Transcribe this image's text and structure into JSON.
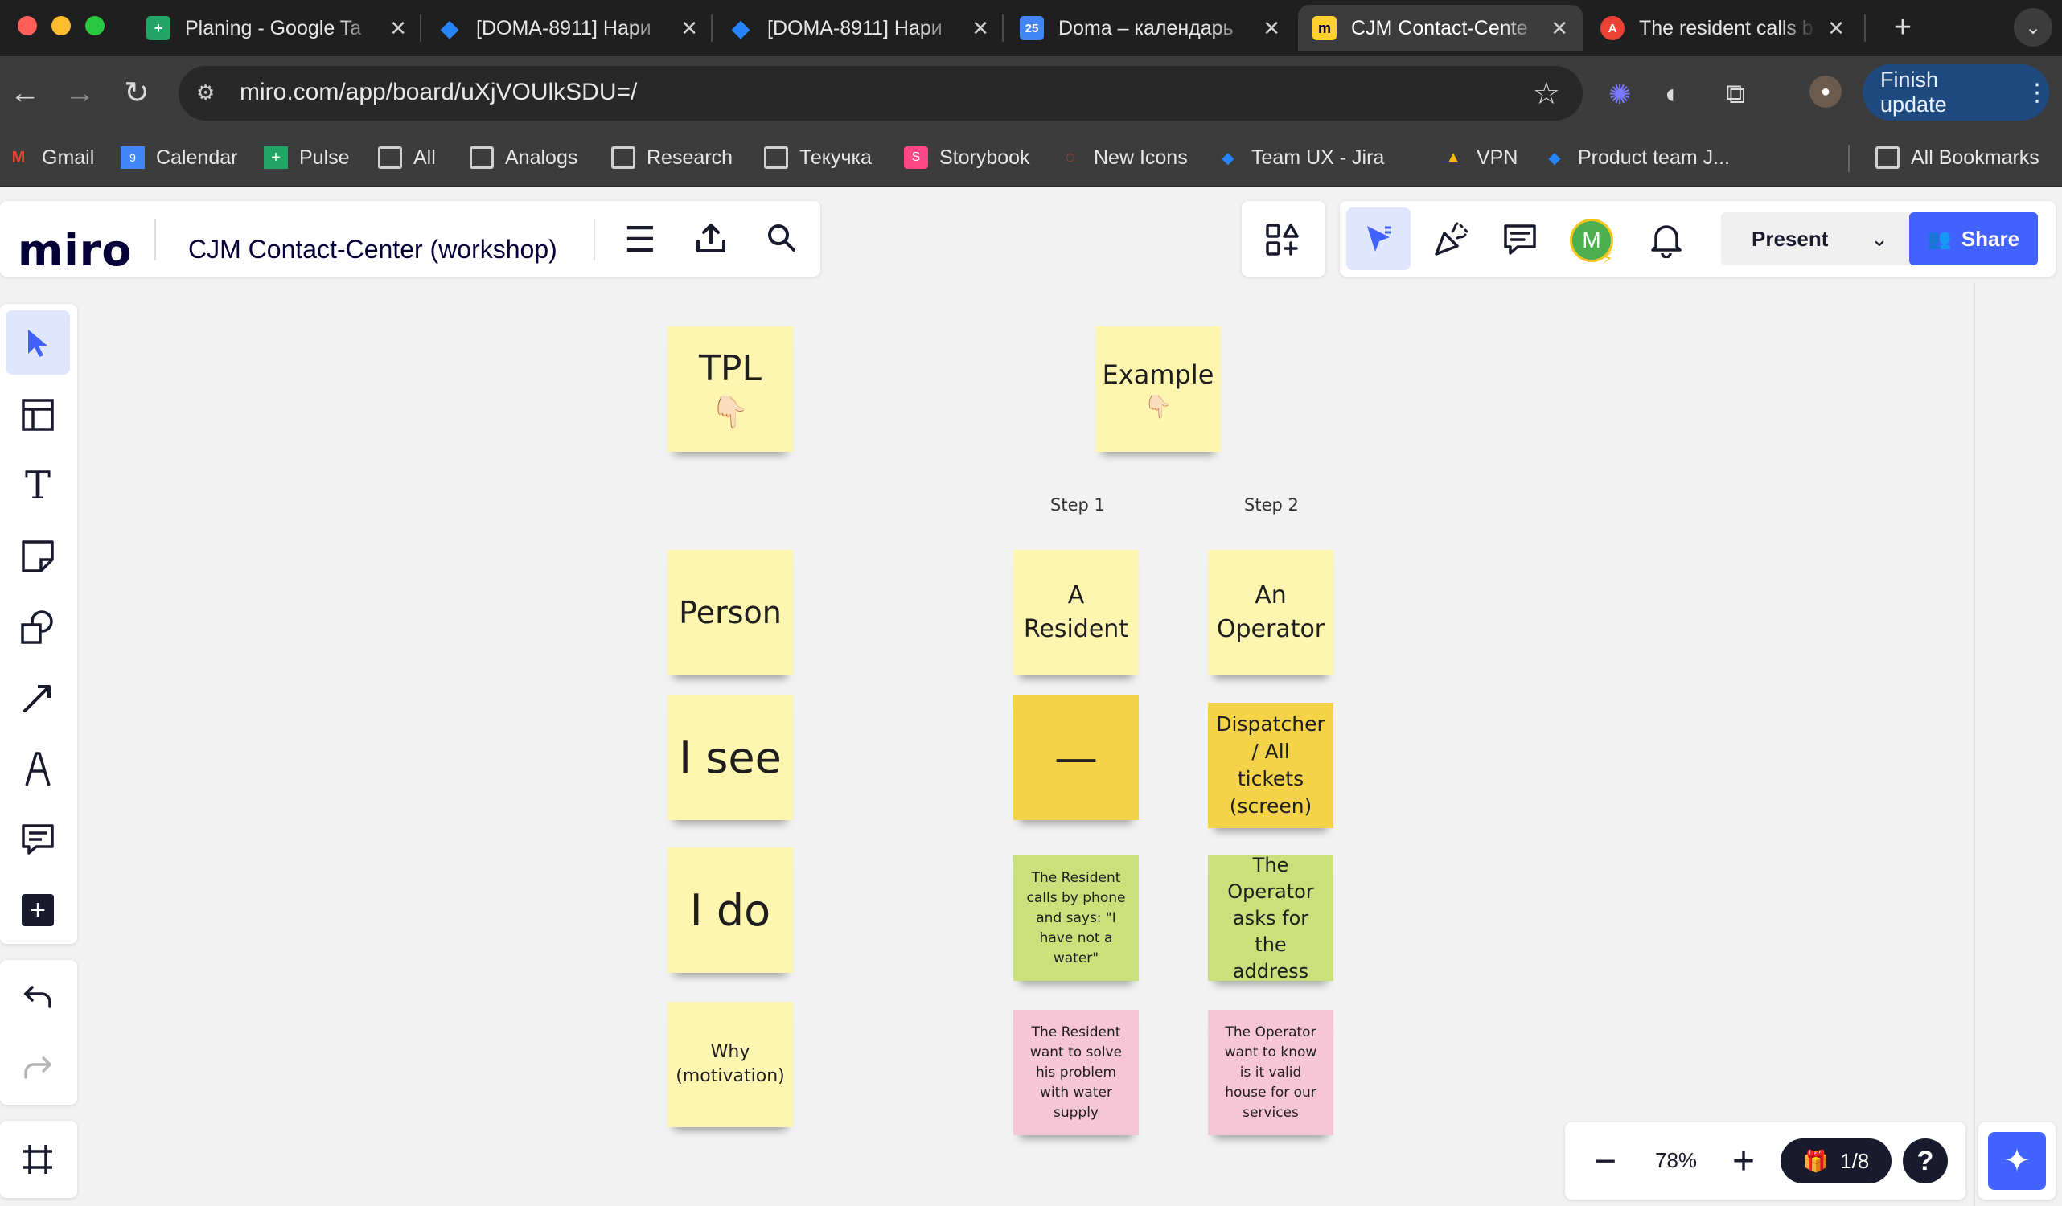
{
  "browser": {
    "tabs": [
      {
        "title": "Planing - Google Ta",
        "icon": "sheets-icon",
        "color": "#23a566"
      },
      {
        "title": "[DOMA-8911] Нари",
        "icon": "jira-icon",
        "color": "#2684ff"
      },
      {
        "title": "[DOMA-8911] Нари",
        "icon": "jira-icon",
        "color": "#2684ff"
      },
      {
        "title": "Doma – календарь",
        "icon": "calendar-icon",
        "color": "#4285f4"
      },
      {
        "title": "CJM Contact-Cente",
        "icon": "miro-icon",
        "color": "#ffd02f",
        "active": true
      },
      {
        "title": "The resident calls b",
        "icon": "translate-icon",
        "color": "#ea4335"
      }
    ],
    "url": "miro.com/app/board/uXjVOUlkSDU=/",
    "finish_update": "Finish update",
    "bookmarks": [
      "Gmail",
      "Calendar",
      "Pulse",
      "All",
      "Analogs",
      "Research",
      "Текучка",
      "Storybook",
      "New Icons",
      "Team UX - Jira",
      "VPN",
      "Product team J...",
      "All Bookmarks"
    ]
  },
  "miro": {
    "logo": "miro",
    "board_name": "CJM Contact-Center (workshop)",
    "avatar_letter": "M",
    "present": "Present",
    "share": "Share",
    "zoom": "78%",
    "pages": "1/8",
    "help": "?"
  },
  "board": {
    "tpl_title": "TPL",
    "tpl_icon": "👇🏻",
    "example_title": "Example",
    "example_icon": "👇🏻",
    "step1": "Step 1",
    "step2": "Step 2",
    "rows": [
      "Person",
      "I see",
      "I do",
      "Why (motivation)"
    ],
    "step1_notes": [
      "A Resident",
      "—",
      "The Resident calls by phone and says: \"I have not a water\"",
      "The Resident want to solve his problem with water supply"
    ],
    "step2_notes": [
      "An Operator",
      "Dispatcher / All tickets (screen)",
      "The Operator asks for the address",
      "The Operator want to know is it valid house for our services"
    ]
  }
}
